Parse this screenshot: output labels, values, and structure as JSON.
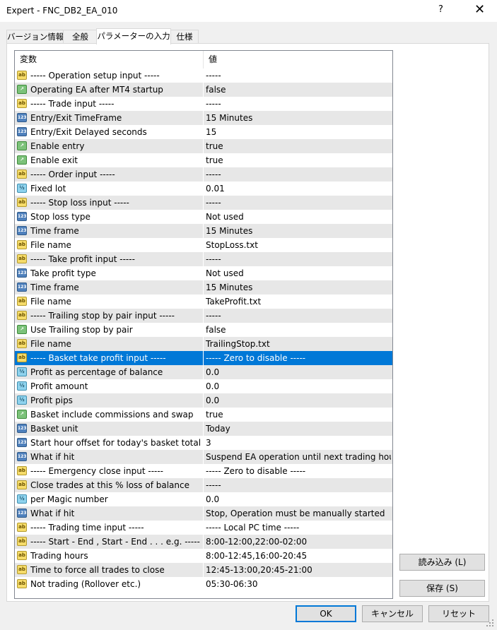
{
  "window": {
    "title": "Expert - FNC_DB2_EA_010",
    "help": "?",
    "close": "✕"
  },
  "tabs": [
    {
      "label": "バージョン情報"
    },
    {
      "label": "全般"
    },
    {
      "label": "パラメーターの入力"
    },
    {
      "label": "仕様"
    }
  ],
  "grid": {
    "columns": {
      "name": "変数",
      "value": "値"
    },
    "rows": [
      {
        "icon": "ab",
        "name": "----- Operation setup input -----",
        "value": "-----"
      },
      {
        "icon": "bool",
        "name": "Operating EA after MT4 startup",
        "value": "false"
      },
      {
        "icon": "ab",
        "name": "----- Trade input -----",
        "value": "-----"
      },
      {
        "icon": "n123",
        "name": "Entry/Exit TimeFrame",
        "value": "15 Minutes"
      },
      {
        "icon": "n123",
        "name": "Entry/Exit Delayed seconds",
        "value": "15"
      },
      {
        "icon": "bool",
        "name": "Enable entry",
        "value": "true"
      },
      {
        "icon": "bool",
        "name": "Enable exit",
        "value": "true"
      },
      {
        "icon": "ab",
        "name": "----- Order input -----",
        "value": "-----"
      },
      {
        "icon": "dbl",
        "name": "Fixed lot",
        "value": "0.01"
      },
      {
        "icon": "ab",
        "name": "----- Stop loss input -----",
        "value": "-----"
      },
      {
        "icon": "n123",
        "name": "Stop loss type",
        "value": "Not used"
      },
      {
        "icon": "n123",
        "name": "Time frame",
        "value": "15 Minutes"
      },
      {
        "icon": "ab",
        "name": "File name",
        "value": "StopLoss.txt"
      },
      {
        "icon": "ab",
        "name": "----- Take profit input -----",
        "value": "-----"
      },
      {
        "icon": "n123",
        "name": "Take profit type",
        "value": "Not used"
      },
      {
        "icon": "n123",
        "name": "Time frame",
        "value": "15 Minutes"
      },
      {
        "icon": "ab",
        "name": "File name",
        "value": "TakeProfit.txt"
      },
      {
        "icon": "ab",
        "name": "----- Trailing stop by pair input -----",
        "value": "-----"
      },
      {
        "icon": "bool",
        "name": "Use Trailing stop by pair",
        "value": "false"
      },
      {
        "icon": "ab",
        "name": "File name",
        "value": "TrailingStop.txt"
      },
      {
        "icon": "ab",
        "name": "----- Basket take profit input -----",
        "value": "----- Zero to disable -----"
      },
      {
        "icon": "dbl",
        "name": "Profit as percentage of balance",
        "value": "0.0"
      },
      {
        "icon": "dbl",
        "name": "Profit amount",
        "value": "0.0"
      },
      {
        "icon": "dbl",
        "name": "Profit pips",
        "value": "0.0"
      },
      {
        "icon": "bool",
        "name": "Basket include commissions and swap",
        "value": "true"
      },
      {
        "icon": "n123",
        "name": "Basket unit",
        "value": "Today"
      },
      {
        "icon": "n123",
        "name": "Start hour offset for today's basket total",
        "value": "3"
      },
      {
        "icon": "n123",
        "name": "What if hit",
        "value": "Suspend EA operation until next trading hours"
      },
      {
        "icon": "ab",
        "name": "----- Emergency close input -----",
        "value": "----- Zero to disable -----"
      },
      {
        "icon": "ab",
        "name": "Close trades at this % loss of balance",
        "value": "-----"
      },
      {
        "icon": "dbl",
        "name": "per Magic number",
        "value": "0.0"
      },
      {
        "icon": "n123",
        "name": "What if hit",
        "value": "Stop, Operation must be manually started"
      },
      {
        "icon": "ab",
        "name": "----- Trading time input -----",
        "value": "----- Local PC time -----"
      },
      {
        "icon": "ab",
        "name": "----- Start - End , Start - End . . . e.g. -----",
        "value": "8:00-12:00,22:00-02:00"
      },
      {
        "icon": "ab",
        "name": "Trading hours",
        "value": "8:00-12:45,16:00-20:45"
      },
      {
        "icon": "ab",
        "name": "Time to force all trades to close",
        "value": "12:45-13:00,20:45-21:00"
      },
      {
        "icon": "ab",
        "name": "Not trading (Rollover etc.)",
        "value": "05:30-06:30"
      }
    ]
  },
  "icon_glyphs": {
    "ab": "ab",
    "n123": "123",
    "bool": "↗",
    "dbl": "½"
  },
  "buttons": {
    "load": "読み込み (L)",
    "save": "保存 (S)",
    "ok": "OK",
    "cancel": "キャンセル",
    "reset": "リセット"
  }
}
